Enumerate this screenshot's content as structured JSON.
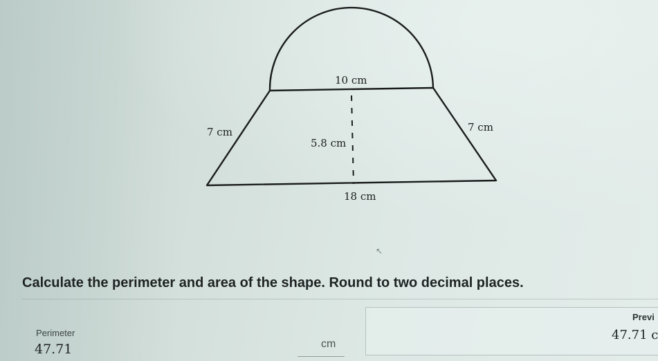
{
  "figure": {
    "labels": {
      "top_width": "10 cm",
      "left_side": "7 cm",
      "right_side": "7 cm",
      "height": "5.8 cm",
      "bottom_width": "18 cm"
    }
  },
  "question": {
    "text": "Calculate the perimeter and area of the shape. Round to two decimal places."
  },
  "perimeter": {
    "label": "Perimeter",
    "value": "47.71",
    "unit": "cm"
  },
  "preview": {
    "label": "Previ",
    "value": "47.71 c"
  },
  "icons": {
    "cursor": "mouse-pointer-icon"
  }
}
